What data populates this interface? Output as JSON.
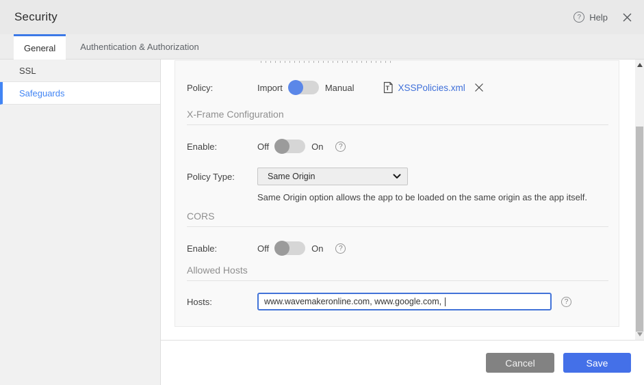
{
  "header": {
    "title": "Security",
    "help_label": "Help"
  },
  "tabs": [
    {
      "label": "General",
      "active": true
    },
    {
      "label": "Authentication & Authorization",
      "active": false
    }
  ],
  "sidebar": {
    "items": [
      {
        "label": "SSL",
        "active": false
      },
      {
        "label": "Safeguards",
        "active": true
      }
    ]
  },
  "form": {
    "policy": {
      "label": "Policy:",
      "toggle_left": "Import",
      "toggle_right": "Manual",
      "toggle_state": "Import",
      "file_name": "XSSPolicies.xml"
    },
    "xframe": {
      "section_title": "X-Frame Configuration",
      "enable_label": "Enable:",
      "off": "Off",
      "on": "On",
      "enable_state": "Off",
      "policy_type_label": "Policy Type:",
      "policy_type_value": "Same Origin",
      "helper_text": "Same Origin option allows the app to be loaded on the same origin as the app itself."
    },
    "cors": {
      "section_title": "CORS",
      "enable_label": "Enable:",
      "off": "Off",
      "on": "On",
      "enable_state": "Off"
    },
    "allowed_hosts": {
      "section_title": "Allowed Hosts",
      "hosts_label": "Hosts:",
      "hosts_value": "www.wavemakeronline.com, www.google.com, "
    }
  },
  "footer": {
    "cancel_label": "Cancel",
    "save_label": "Save"
  },
  "colors": {
    "accent-blue": "#3b78e7",
    "toggle-blue": "#5b87e8",
    "link-blue": "#3e6fd9",
    "save-blue": "#4470e8",
    "cancel-gray": "#828282",
    "sidebar-active-blue": "#4285f4",
    "focus-border": "#4273d8"
  }
}
